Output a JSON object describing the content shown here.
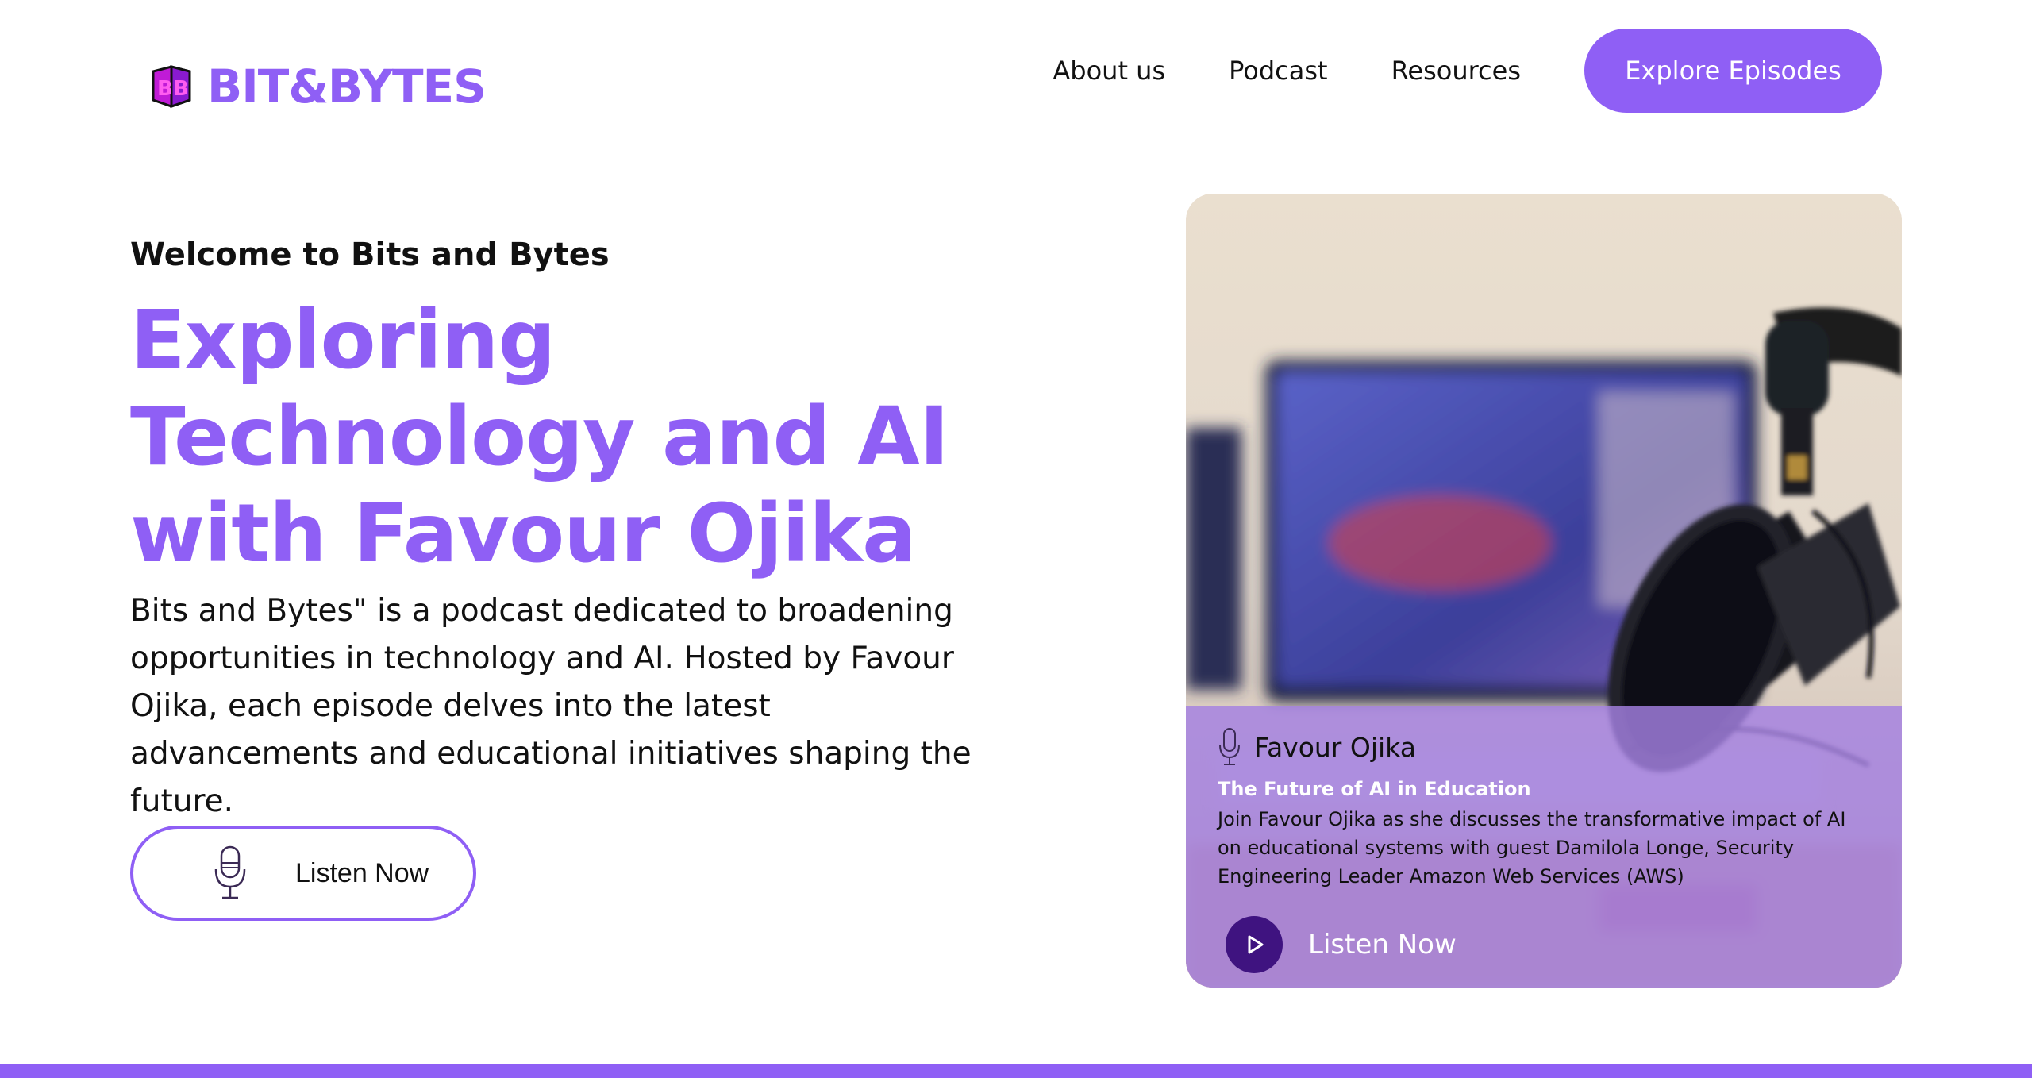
{
  "brand": {
    "name": "BIT&BYTES",
    "color": "#8f5ff5",
    "logo_icon": "bb-cube-logo-icon"
  },
  "nav": {
    "items": [
      "About us",
      "Podcast",
      "Resources"
    ],
    "cta": "Explore Episodes"
  },
  "hero": {
    "eyebrow": "Welcome to Bits and Bytes",
    "headline": "Exploring Technology and AI with Favour Ojika",
    "description": "Bits and Bytes\" is a podcast dedicated to broadening opportunities in technology and AI. Hosted by Favour Ojika, each episode delves into the latest advancements and educational initiatives shaping the future.",
    "listen_button": "Listen Now",
    "listen_icon": "microphone-icon"
  },
  "episode_card": {
    "image": "podcast-microphone-studio-photo",
    "host": "Favour Ojika",
    "host_icon": "microphone-icon",
    "title": "The Future of AI in Education",
    "description": "Join Favour Ojika as she discusses the transformative impact of AI on educational systems with guest Damilola Longe, Security Engineering Leader Amazon Web Services (AWS)",
    "play_label": "Listen Now",
    "play_icon": "play-icon",
    "overlay_color": "#a480e2",
    "play_color": "#3f1380"
  }
}
